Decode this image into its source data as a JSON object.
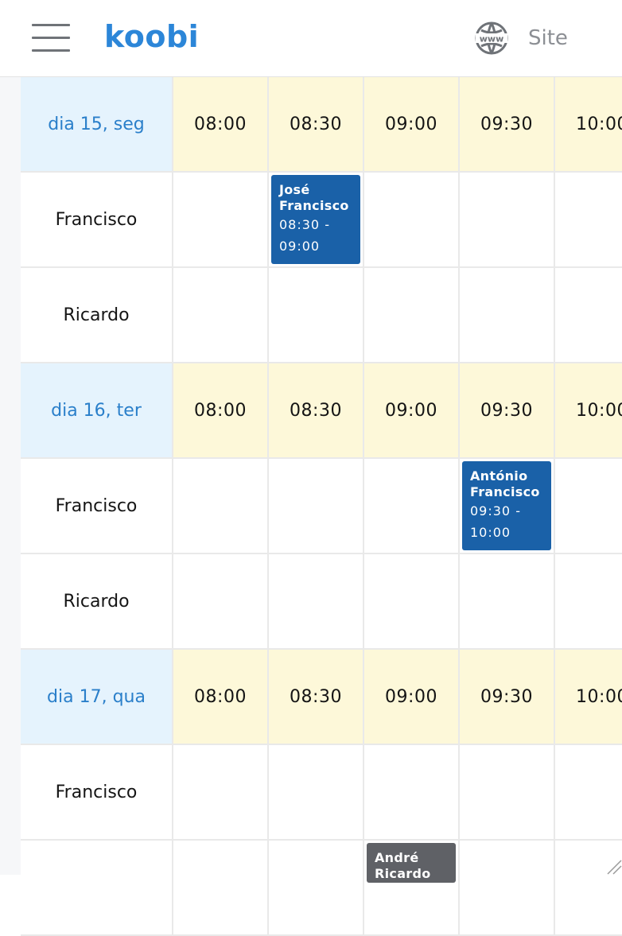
{
  "header": {
    "logo": "koobi",
    "site_label": "Site",
    "menu_icon": "hamburger-menu-icon",
    "site_icon": "globe-www-icon"
  },
  "colors": {
    "brand": "#2c86d8",
    "day_label_bg": "#e5f3fd",
    "time_header_bg": "#fdf8d9",
    "appointment_blue": "#1a61a8",
    "appointment_gray": "#5f6166"
  },
  "schedule": {
    "days": [
      {
        "label": "dia 15, seg",
        "times": [
          "08:00",
          "08:30",
          "09:00",
          "09:30",
          "10:00"
        ],
        "staff": [
          {
            "name": "Francisco"
          },
          {
            "name": "Ricardo"
          }
        ]
      },
      {
        "label": "dia 16, ter",
        "times": [
          "08:00",
          "08:30",
          "09:00",
          "09:30",
          "10:00"
        ],
        "staff": [
          {
            "name": "Francisco"
          },
          {
            "name": "Ricardo"
          }
        ]
      },
      {
        "label": "dia 17, qua",
        "times": [
          "08:00",
          "08:30",
          "09:00",
          "09:30",
          "10:00"
        ],
        "staff": [
          {
            "name": "Francisco"
          },
          {
            "name": ""
          }
        ]
      }
    ],
    "appointments": [
      {
        "day": 0,
        "staff": 0,
        "slot": 1,
        "name_line1": "José",
        "name_line2": "Francisco",
        "time_line1": "08:30 -",
        "time_line2": "09:00",
        "color": "#1a61a8"
      },
      {
        "day": 1,
        "staff": 0,
        "slot": 3,
        "name_line1": "António",
        "name_line2": "Francisco",
        "time_line1": "09:30 -",
        "time_line2": "10:00",
        "color": "#1a61a8"
      },
      {
        "day": 2,
        "staff": 1,
        "slot": 2,
        "name_line1": "André",
        "name_line2": "Ricardo",
        "time_line1": "",
        "time_line2": "",
        "color": "#5f6166"
      }
    ]
  }
}
